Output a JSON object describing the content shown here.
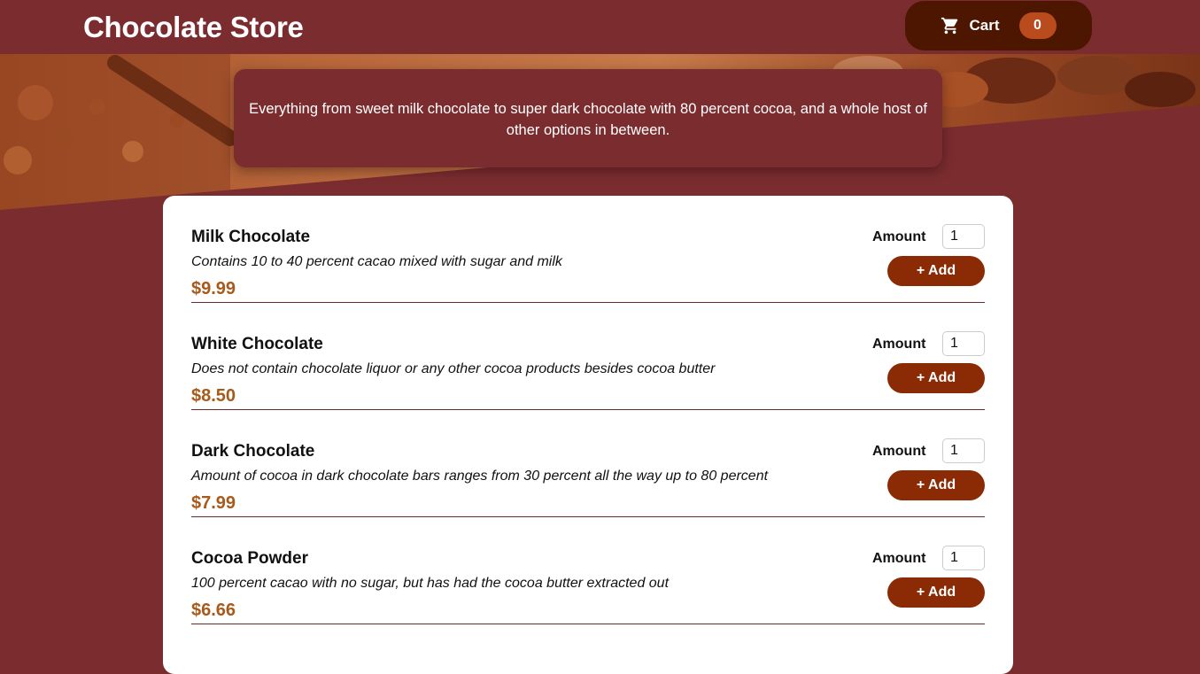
{
  "header": {
    "title": "Chocolate Store",
    "cart_label": "Cart",
    "cart_count": "0"
  },
  "summary": {
    "text": "Everything from sweet milk chocolate to super dark chocolate with 80 percent cocoa, and a whole host of other options in between."
  },
  "meals": [
    {
      "name": "Milk Chocolate",
      "description": "Contains 10 to 40 percent cacao mixed with sugar and milk",
      "price": "$9.99",
      "amount_label": "Amount",
      "amount_value": "1",
      "add_label": "+ Add"
    },
    {
      "name": "White Chocolate",
      "description": "Does not contain chocolate liquor or any other cocoa products besides cocoa butter",
      "price": "$8.50",
      "amount_label": "Amount",
      "amount_value": "1",
      "add_label": "+ Add"
    },
    {
      "name": "Dark Chocolate",
      "description": "Amount of cocoa in dark chocolate bars ranges from 30 percent all the way up to 80 percent",
      "price": "$7.99",
      "amount_label": "Amount",
      "amount_value": "1",
      "add_label": "+ Add"
    },
    {
      "name": "Cocoa Powder",
      "description": "100 percent cacao with no sugar, but has had the cocoa butter extracted out",
      "price": "$6.66",
      "amount_label": "Amount",
      "amount_value": "1",
      "add_label": "+ Add"
    }
  ],
  "colors": {
    "background": "#7b2c2f",
    "cart_button": "#4d1601",
    "cart_badge": "#b94b1c",
    "add_button": "#8a2b06",
    "price": "#a85a1a"
  },
  "icons": {
    "cart": "shopping-cart-icon"
  }
}
